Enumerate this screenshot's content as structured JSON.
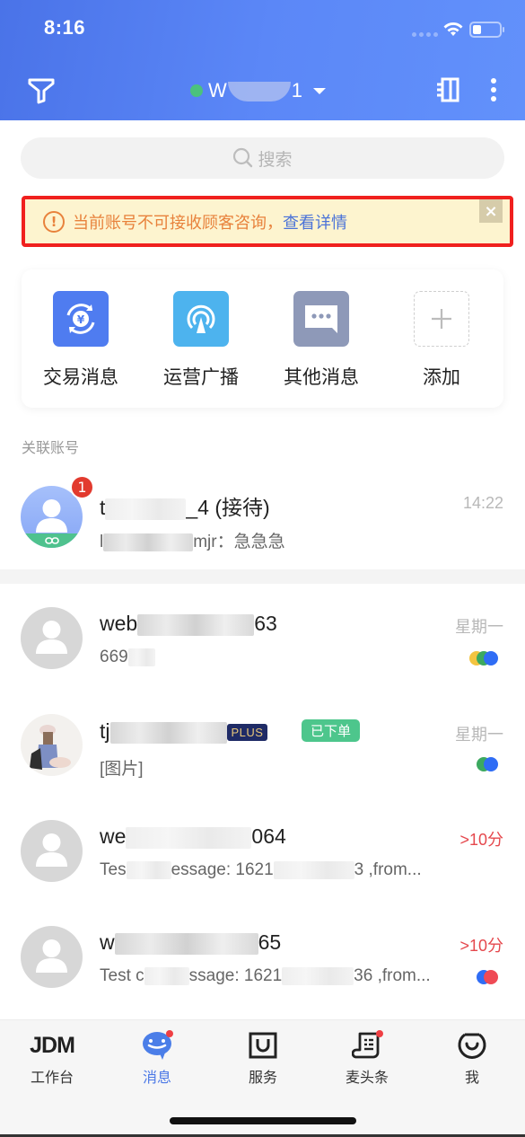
{
  "status_bar": {
    "time": "8:16"
  },
  "header": {
    "account_prefix": "W",
    "account_suffix": "1",
    "online_color": "#4bc27d",
    "filter_icon": "filter-icon",
    "contacts_icon": "contacts-icon",
    "more_icon": "more-vertical-icon"
  },
  "search": {
    "placeholder": "搜索"
  },
  "alert": {
    "message": "当前账号不可接收顾客咨询，",
    "link": "查看详情",
    "close": "×"
  },
  "shortcuts": [
    {
      "label": "交易消息",
      "icon": "transaction-icon",
      "color": "#4f7cf0"
    },
    {
      "label": "运营广播",
      "icon": "broadcast-icon",
      "color": "#4db3ee"
    },
    {
      "label": "其他消息",
      "icon": "message-icon",
      "color": "#8e99b8"
    },
    {
      "label": "添加",
      "icon": "plus-icon"
    }
  ],
  "linked_section": {
    "label": "关联账号",
    "item": {
      "name_prefix": "t",
      "name_suffix": "_4 (接待)",
      "preview_prefix": "l",
      "preview_suffix": "mjr：急急急",
      "time": "14:22",
      "unread": "1"
    }
  },
  "conversations": [
    {
      "name_prefix": "web",
      "name_suffix": "63",
      "preview_prefix": "669",
      "preview_suffix": "",
      "time": "星期一",
      "time_alert": false,
      "channels": [
        "#f3c440",
        "#3ca95f",
        "#2f6df5"
      ]
    },
    {
      "name_prefix": "tj",
      "name_suffix": "",
      "plus_tag": "PLUS",
      "order_tag": "已下单",
      "preview_prefix": "[图片]",
      "preview_suffix": "",
      "time": "星期一",
      "time_alert": false,
      "channels": [
        "#3ca95f",
        "#2f6df5"
      ]
    },
    {
      "name_prefix": "we",
      "name_suffix": "064",
      "preview_prefix": "Tes",
      "preview_mid": "essage: 1621",
      "preview_suffix": "3 ,from...",
      "time": ">10分",
      "time_alert": true,
      "channels": []
    },
    {
      "name_prefix": "w",
      "name_suffix": "65",
      "preview_prefix": "Test c",
      "preview_mid": "ssage: 1621",
      "preview_suffix": "36 ,from...",
      "time": ">10分",
      "time_alert": true,
      "channels": [
        "#2f6df5",
        "#ef4a55"
      ]
    }
  ],
  "tabbar": {
    "items": [
      {
        "label": "工作台",
        "icon": "jdm-logo-icon",
        "active": false,
        "dot": false
      },
      {
        "label": "消息",
        "icon": "chat-bubble-icon",
        "active": true,
        "dot": true
      },
      {
        "label": "服务",
        "icon": "service-bag-icon",
        "active": false,
        "dot": false
      },
      {
        "label": "麦头条",
        "icon": "news-scroll-icon",
        "active": false,
        "dot": true
      },
      {
        "label": "我",
        "icon": "profile-smile-icon",
        "active": false,
        "dot": false
      }
    ],
    "jdm_logo_text": "JDM",
    "active_color": "#4b78e6"
  }
}
